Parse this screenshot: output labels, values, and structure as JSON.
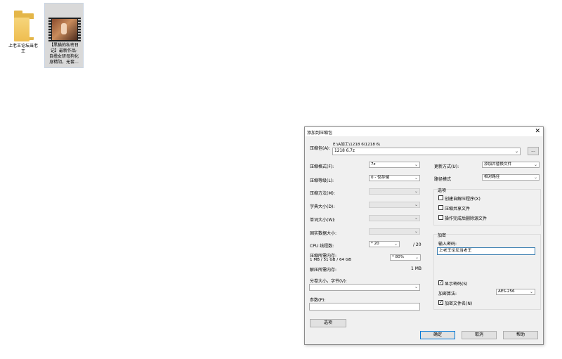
{
  "desktop": {
    "folder_label": "上老王论坛当老\n王",
    "video_label": "【黑猫的私密日\n记】最新作品-\n自撸女研母狗化\n身精阴，无套..."
  },
  "dialog": {
    "title": "添加到压缩包",
    "close_glyph": "✕",
    "archive_label": "压缩包(A):",
    "archive_dir": "E:\\A加工\\1218 6\\1218 6\\",
    "archive_name": "1218 6.7z",
    "browse_label": "...",
    "left": {
      "format_label": "压缩格式(F):",
      "format_value": "7z",
      "level_label": "压缩等级(L):",
      "level_value": "0 - 仅存储",
      "method_label": "压缩方法(M):",
      "dict_label": "字典大小(D):",
      "word_label": "单词大小(W):",
      "solid_label": "固实数据大小:",
      "cpu_label": "CPU 线程数:",
      "cpu_value": "* 20",
      "cpu_total": "/ 20",
      "mem_label": "压缩所需内存:",
      "mem_detail": "1 MB / 51 GB / 64 GB",
      "mem_percent": "* 80%",
      "decomp_label": "解压所需内存:",
      "decomp_value": "1 MB",
      "split_label": "分卷大小，字节(V):",
      "params_label": "参数(P):",
      "options_button": "选项"
    },
    "right": {
      "update_label": "更新方式(U):",
      "update_value": "添加并替换文件",
      "path_label": "路径模式",
      "path_value": "相对路径",
      "options_group": "选项",
      "opt_sfx": "创建自解压程序(X)",
      "opt_shared": "压缩共享文件",
      "opt_delete": "操作完成后删除源文件",
      "encrypt_group": "加密",
      "password_label": "输入密码:",
      "password_value": "上老王论坛当老王",
      "show_password": "显示密码(S)",
      "enc_method_label": "加密算法:",
      "enc_method_value": "AES-256",
      "encrypt_names": "加密文件名(N)"
    },
    "buttons": {
      "ok": "确定",
      "cancel": "取消",
      "help": "帮助"
    },
    "check_glyph": "✓",
    "arrow_glyph": "⌄"
  }
}
